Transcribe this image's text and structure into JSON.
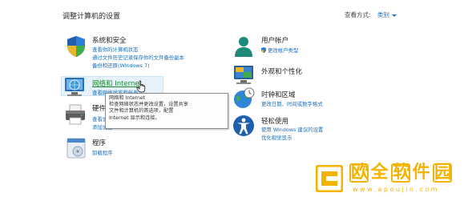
{
  "header": {
    "title": "调整计算机的设置",
    "view_by_label": "查看方式:",
    "view_by_value": "类别"
  },
  "categories": [
    {
      "title": "系统和安全",
      "links": [
        "查看你的计算机状态",
        "通过文件历史记录保存你的文件备份副本",
        "备份和还原(Windows 7)"
      ]
    },
    {
      "title": "网络和 Internet",
      "links": [
        "查看网络状态和任务"
      ]
    },
    {
      "title": "硬件和声音",
      "links": [
        "查看设备和打印机",
        "添加设备"
      ]
    },
    {
      "title": "程序",
      "links": [
        "卸载程序"
      ]
    },
    {
      "title": "用户帐户",
      "links": [
        "更改帐户类型"
      ]
    },
    {
      "title": "外观和个性化",
      "links": []
    },
    {
      "title": "时钟和区域",
      "links": [
        "更改日期、时间或数字格式"
      ]
    },
    {
      "title": "轻松使用",
      "links": [
        "使用 Windows 建议的设置",
        "优化视觉显示"
      ]
    }
  ],
  "tooltip": {
    "lines": [
      "网络和 Internet",
      "检查网络状态并更改设置，设置共享",
      "文件和计算机的首选项，配置",
      "Internet 显示和连接。"
    ]
  },
  "watermark": {
    "chars": [
      "欧",
      "全",
      "软",
      "件",
      "园"
    ],
    "url": "www.apoujin.com"
  },
  "colors": {
    "link": "#1a6fbd",
    "hover_title": "#1f8a2e",
    "watermark": "#f2b400"
  }
}
